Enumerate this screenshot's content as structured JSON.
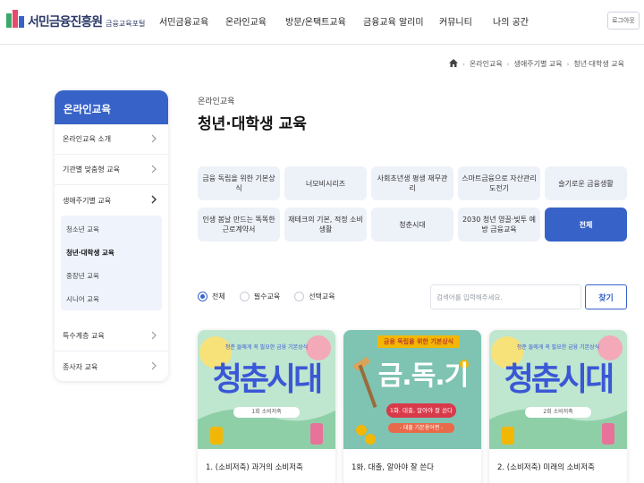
{
  "header": {
    "logo_text": "서민금융진흥원",
    "logo_sub": "금융교육포털",
    "nav": [
      "서민금융교육",
      "온라인교육",
      "방문/온택트교육",
      "금융교육 알리미",
      "커뮤니티",
      "나의 공간"
    ],
    "login_label": "로그아웃"
  },
  "breadcrumb": [
    "온라인교육",
    "생애주기별 교육",
    "청년·대학생 교육"
  ],
  "sidebar": {
    "title": "온라인교육",
    "items": [
      "온라인교육 소개",
      "기관별 맞춤형 교육",
      "생애주기별 교육",
      "특수계층 교육",
      "종사자 교육"
    ],
    "sub_items": [
      "청소년 교육",
      "청년·대학생 교육",
      "중장년 교육",
      "시니어 교육"
    ],
    "active_sub_item": "청년·대학생 교육"
  },
  "main": {
    "sub_title": "온라인교육",
    "title": "청년·대학생 교육",
    "tags": [
      "금융 독립을 위한 기본상식",
      "너모비시리즈",
      "사회초년생 평생 재무관리",
      "스마트금융으로 자산관리 도전기",
      "슬기로운 금융생활",
      "인생 봄날 만드는 똑똑한 근로계약서",
      "재테크의 기본, 적정 소비 생활",
      "청춘시대",
      "2030 청년 영끌·빚투 예방 금융교육",
      "전체"
    ],
    "active_tag": "전체",
    "filters": [
      "전체",
      "필수교육",
      "선택교육"
    ],
    "selected_filter": "전체",
    "search": {
      "placeholder": "검색어를 입력해주세요.",
      "button": "찾기"
    }
  },
  "cards": [
    {
      "title": "1. (소비저축) 과거의 소비저축",
      "thumb_top": "청춘 들에게 꼭 필요한 금융 기본상식",
      "thumb_main": "청춘시대",
      "thumb_badge": "1회 소비저축"
    },
    {
      "title": "1화. 대출, 알아야 잘 쓴다",
      "thumb_top": "금융 독립을 위한 기본상식",
      "thumb_main": "금.독.기",
      "thumb_badge": "1화. 대출, 알아야 잘 쓴다",
      "thumb_caption": "- 대출 기본용어편 -"
    },
    {
      "title": "2. (소비저축) 미래의 소비저축",
      "thumb_top": "청춘 들에게 꼭 필요한 금융 기본상식",
      "thumb_main": "청춘시대",
      "thumb_badge": "2회 소비저축"
    }
  ],
  "colors": {
    "accent": "#3763c8",
    "tag_bg": "#edf1f8",
    "sub_bg": "#eef3fc",
    "thumb_green": "#8fcfa8",
    "thumb_teal": "#7fc3b2",
    "headline_blue": "#3a57d6",
    "badge_red": "#d93a4a",
    "badge_gold": "#f2b705"
  }
}
